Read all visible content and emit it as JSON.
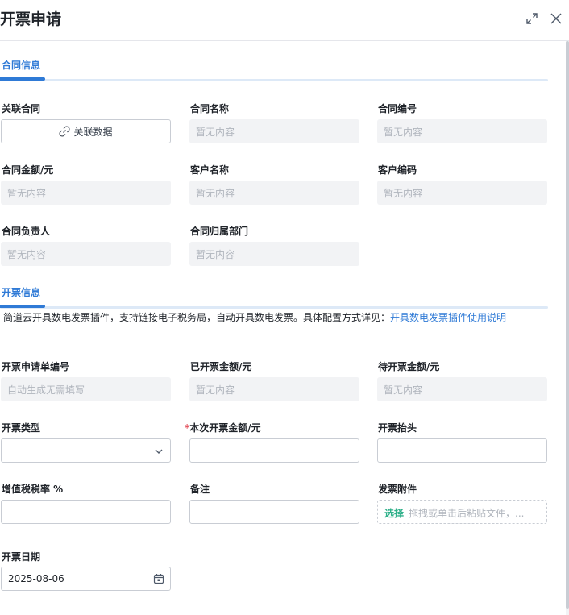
{
  "dialog": {
    "title": "开票申请"
  },
  "sections": {
    "contract": {
      "label": "合同信息"
    },
    "invoice": {
      "label": "开票信息"
    }
  },
  "contract": {
    "related_contract": {
      "label": "关联合同",
      "button": "关联数据"
    },
    "contract_name": {
      "label": "合同名称",
      "value": "暂无内容"
    },
    "contract_no": {
      "label": "合同编号",
      "value": "暂无内容"
    },
    "contract_amount": {
      "label": "合同金额/元",
      "value": "暂无内容"
    },
    "customer_name": {
      "label": "客户名称",
      "value": "暂无内容"
    },
    "customer_code": {
      "label": "客户编码",
      "value": "暂无内容"
    },
    "contract_owner": {
      "label": "合同负责人",
      "value": "暂无内容"
    },
    "contract_dept": {
      "label": "合同归属部门",
      "value": "暂无内容"
    }
  },
  "invoice": {
    "note_text": "简道云开具数电发票插件，支持链接电子税务局，自动开具数电发票。具体配置方式详见：",
    "note_link": "开具数电发票插件使用说明",
    "apply_no": {
      "label": "开票申请单编号",
      "value": "自动生成无需填写"
    },
    "invoiced_amount": {
      "label": "已开票金额/元",
      "value": "暂无内容"
    },
    "pending_amount": {
      "label": "待开票金额/元",
      "value": "暂无内容"
    },
    "invoice_type": {
      "label": "开票类型",
      "value": ""
    },
    "current_amount": {
      "label": "本次开票金额/元",
      "required_mark": "*",
      "value": ""
    },
    "invoice_header": {
      "label": "开票抬头",
      "value": ""
    },
    "vat_rate": {
      "label": "增值税税率 %",
      "value": ""
    },
    "remark": {
      "label": "备注",
      "value": ""
    },
    "attachment": {
      "label": "发票附件",
      "button": "选择",
      "hint": "拖拽或单击后粘贴文件，..."
    },
    "invoice_date": {
      "label": "开票日期",
      "value": "2025-08-06"
    }
  },
  "colors": {
    "accent": "#2f7ad6",
    "attach_accent": "#2fb08a",
    "required": "#e34d59",
    "readonly_bg": "#f2f3f5"
  },
  "icons": [
    "expand-icon",
    "close-icon",
    "link-icon",
    "chevron-down-icon",
    "calendar-icon"
  ]
}
